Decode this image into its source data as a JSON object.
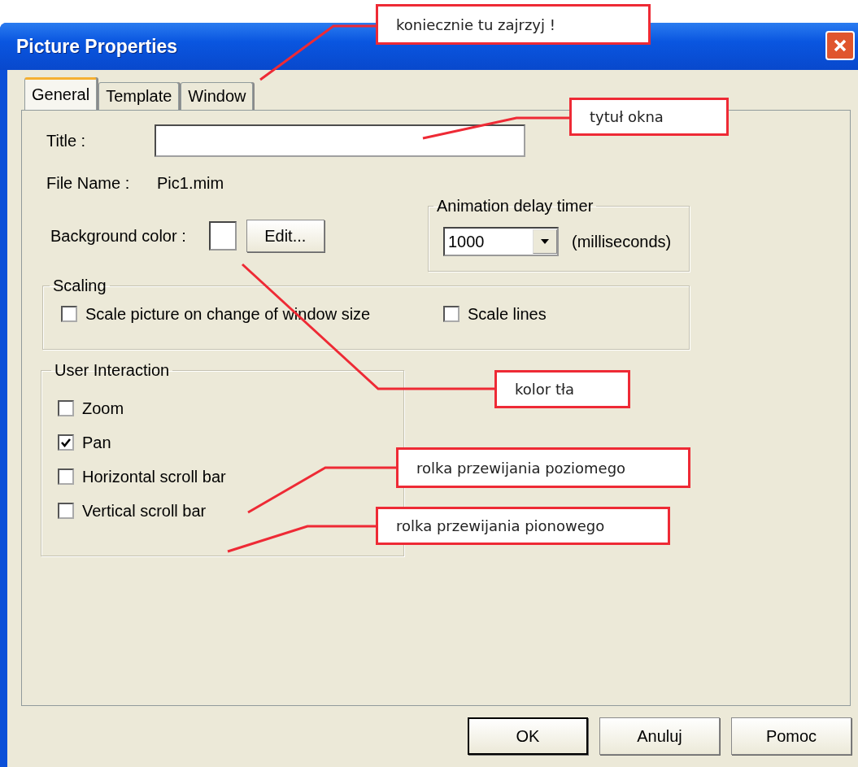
{
  "window": {
    "title": "Picture Properties"
  },
  "tabs": [
    {
      "label": "General",
      "selected": true
    },
    {
      "label": "Template",
      "selected": false
    },
    {
      "label": "Window",
      "selected": false
    }
  ],
  "title_field": {
    "label": "Title :"
  },
  "file_name": {
    "label": "File Name :",
    "value": "Pic1.mim"
  },
  "background_color": {
    "label": "Background color :",
    "button": "Edit..."
  },
  "animation_delay": {
    "title": "Animation delay timer",
    "value": "1000",
    "unit": "(milliseconds)"
  },
  "scaling": {
    "title": "Scaling",
    "options": [
      {
        "label": "Scale picture on change of window size",
        "checked": false
      },
      {
        "label": "Scale lines",
        "checked": false
      }
    ]
  },
  "user_interaction": {
    "title": "User Interaction",
    "options": [
      {
        "label": "Zoom",
        "checked": false
      },
      {
        "label": "Pan",
        "checked": true
      },
      {
        "label": "Horizontal scroll bar",
        "checked": false
      },
      {
        "label": "Vertical scroll bar",
        "checked": false
      }
    ]
  },
  "buttons": [
    {
      "label": "OK",
      "default": true
    },
    {
      "label": "Anuluj",
      "default": false
    },
    {
      "label": "Pomoc",
      "default": false
    }
  ],
  "callouts": [
    {
      "text": "koniecznie tu zajrzyj !"
    },
    {
      "text": "tytuł okna"
    },
    {
      "text": "kolor tła"
    },
    {
      "text": "rolka przewijania poziomego"
    },
    {
      "text": "rolka przewijania pionowego"
    }
  ]
}
